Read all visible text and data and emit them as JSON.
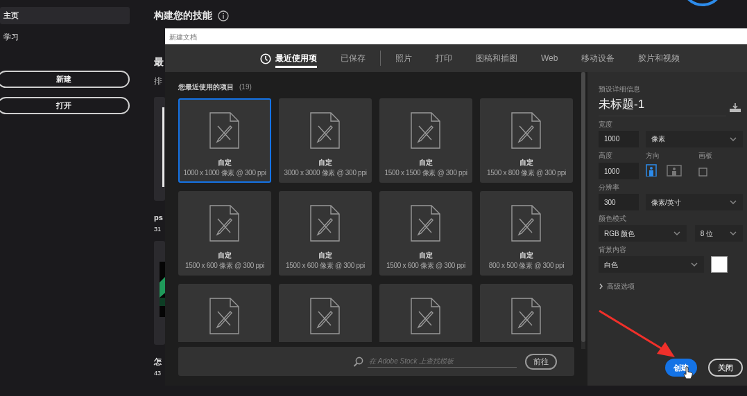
{
  "sidebar": {
    "items": [
      {
        "label": "主页",
        "selected": true
      },
      {
        "label": "学习",
        "selected": false
      }
    ],
    "buttons": [
      "新建",
      "打开"
    ]
  },
  "home": {
    "heading": "构建您的技能",
    "section_title": "最",
    "section_subtitle": "排",
    "tutorials": [
      {
        "title": "ps",
        "duration": "31"
      },
      {
        "title": "怎",
        "duration": "43"
      }
    ]
  },
  "dialog": {
    "title": "新建文档",
    "tabs": [
      {
        "kind": "tab",
        "label": "最近使用项",
        "selected": true
      },
      {
        "kind": "tab",
        "label": "已保存",
        "selected": false
      },
      {
        "kind": "separator"
      },
      {
        "kind": "tab",
        "label": "照片",
        "selected": false
      },
      {
        "kind": "tab",
        "label": "打印",
        "selected": false
      },
      {
        "kind": "tab",
        "label": "图稿和插图",
        "selected": false
      },
      {
        "kind": "tab",
        "label": "Web",
        "selected": false
      },
      {
        "kind": "tab",
        "label": "移动设备",
        "selected": false
      },
      {
        "kind": "tab",
        "label": "胶片和视频",
        "selected": false
      }
    ],
    "recent": {
      "heading": "您最近使用的项目",
      "count": "(19)",
      "presets": [
        {
          "name": "自定",
          "size": "1000 x 1000 像素 @ 300 ppi",
          "selected": true
        },
        {
          "name": "自定",
          "size": "3000 x 3000 像素 @ 300 ppi",
          "selected": false
        },
        {
          "name": "自定",
          "size": "1500 x 1500 像素 @ 300 ppi",
          "selected": false
        },
        {
          "name": "自定",
          "size": "1500 x 800 像素 @ 300 ppi",
          "selected": false
        },
        {
          "name": "自定",
          "size": "1500 x 600 像素 @ 300 ppi",
          "selected": false
        },
        {
          "name": "自定",
          "size": "1500 x 600 像素 @ 300 ppi",
          "selected": false
        },
        {
          "name": "自定",
          "size": "1500 x 600 像素 @ 300 ppi",
          "selected": false
        },
        {
          "name": "自定",
          "size": "800 x 500 像素 @ 300 ppi",
          "selected": false
        },
        {
          "selected": false
        },
        {
          "selected": false
        },
        {
          "selected": false
        },
        {
          "selected": false
        }
      ]
    },
    "search": {
      "placeholder": "在 Adobe Stock 上查找模板",
      "button": "前往"
    },
    "details": {
      "heading": "预设详细信息",
      "name": "未标题-1",
      "width": {
        "label": "宽度",
        "value": "1000",
        "unit": "像素"
      },
      "height": {
        "label": "高度",
        "value": "1000"
      },
      "orientation": {
        "label": "方向",
        "options": [
          {
            "kind": "portrait",
            "selected": true
          },
          {
            "kind": "landscape",
            "selected": false
          }
        ]
      },
      "artboard": {
        "label": "画板",
        "checked": false
      },
      "resolution": {
        "label": "分辨率",
        "value": "300",
        "unit": "像素/英寸"
      },
      "color_mode": {
        "label": "颜色模式",
        "mode": "RGB 颜色",
        "depth": "8 位"
      },
      "background": {
        "label": "背景内容",
        "value": "白色",
        "color": "#ffffff"
      },
      "advanced": {
        "label": "高级选项",
        "expanded": false
      }
    },
    "buttons": [
      {
        "label": "创建",
        "kind": "primary"
      },
      {
        "label": "关闭",
        "kind": "secondary"
      }
    ]
  }
}
